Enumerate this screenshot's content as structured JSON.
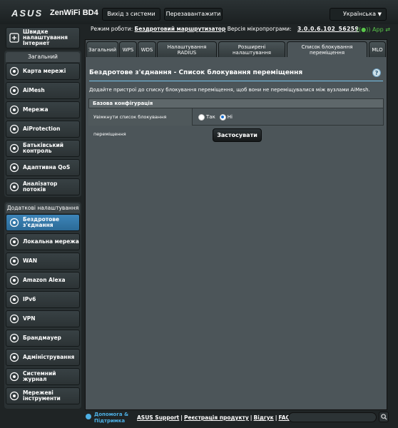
{
  "header": {
    "brand": "ASUS",
    "model": "ZenWiFi BD4",
    "logout_label": "Вихід з системи",
    "reboot_label": "Перезавантажити",
    "language": "Українська"
  },
  "status": {
    "mode_label": "Режим роботи:",
    "mode_value": "Бездротовий маршрутизатор",
    "fw_label": "Версія мікропрограми:",
    "fw_value": "3.0.0.6.102_56259",
    "app_label": "App"
  },
  "sidebar": {
    "quick_setup": "Швидке налаштування Інтернет",
    "general_header": "Загальний",
    "general_items": [
      {
        "label": "Карта мережі",
        "icon": "network-map-icon"
      },
      {
        "label": "AiMesh",
        "icon": "aimesh-icon"
      },
      {
        "label": "Мережа",
        "icon": "network-icon"
      },
      {
        "label": "AiProtection",
        "icon": "aiprotection-icon"
      },
      {
        "label": "Батьківський контроль",
        "icon": "parental-control-icon"
      },
      {
        "label": "Адаптивна QoS",
        "icon": "qos-icon"
      },
      {
        "label": "Аналізатор потоків",
        "icon": "traffic-analyzer-icon"
      }
    ],
    "advanced_header": "Додаткові налаштування",
    "advanced_items": [
      {
        "label": "Бездротове з'єднання",
        "icon": "wireless-icon",
        "active": true
      },
      {
        "label": "Локальна мережа",
        "icon": "lan-icon"
      },
      {
        "label": "WAN",
        "icon": "wan-icon"
      },
      {
        "label": "Amazon Alexa",
        "icon": "alexa-icon"
      },
      {
        "label": "IPv6",
        "icon": "ipv6-icon"
      },
      {
        "label": "VPN",
        "icon": "vpn-icon"
      },
      {
        "label": "Брандмауер",
        "icon": "firewall-icon"
      },
      {
        "label": "Адміністрування",
        "icon": "administration-icon"
      },
      {
        "label": "Системний журнал",
        "icon": "system-log-icon"
      },
      {
        "label": "Мережеві інструменти",
        "icon": "network-tools-icon"
      }
    ]
  },
  "tabs": [
    {
      "label": "Загальний"
    },
    {
      "label": "WPS"
    },
    {
      "label": "WDS"
    },
    {
      "label": "Налаштування RADIUS"
    },
    {
      "label": "Розширені налаштування"
    },
    {
      "label": "Список блокування переміщення",
      "active": true
    },
    {
      "label": "MLO"
    }
  ],
  "main": {
    "title": "Бездротове з'єднання - Список блокування переміщення",
    "description": "Додайте пристрої до списку блокування переміщення, щоб вони не переміщувалися між вузлами AiMesh.",
    "section_header": "Базова конфігурація",
    "row_label": "Увімкнути список блокування переміщення",
    "option_no": "Так",
    "option_yes": "Ні",
    "selected": "Ні",
    "apply_label": "Застосувати"
  },
  "footer": {
    "help_label": "Допомога & Підтримка",
    "links": [
      "ASUS Support",
      "Реєстрація продукту",
      "Відгук",
      "FAQ"
    ],
    "separator": "|"
  },
  "colors": {
    "accent": "#3d85b9",
    "app_green": "#59c74a",
    "link_blue": "#4db0e5"
  }
}
